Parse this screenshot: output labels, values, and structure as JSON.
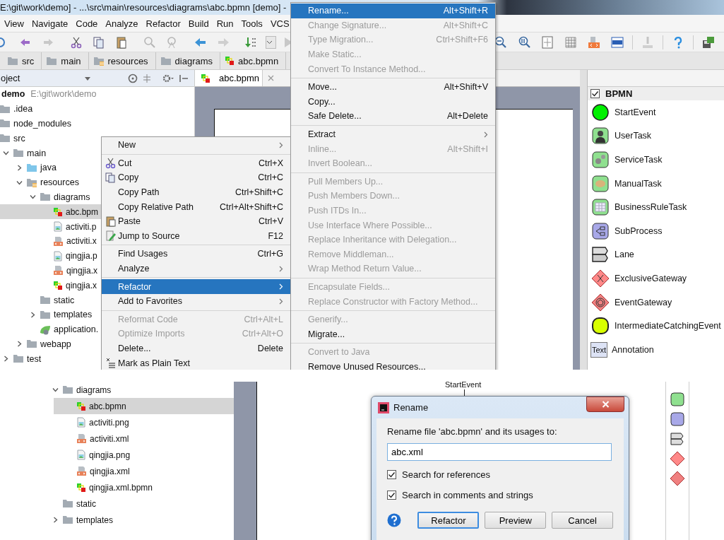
{
  "title_bar": {
    "title": "E:\\git\\work\\demo] - ...\\src\\main\\resources\\diagrams\\abc.bpmn [demo] -"
  },
  "menu_bar": [
    "View",
    "Navigate",
    "Code",
    "Analyze",
    "Refactor",
    "Build",
    "Run",
    "Tools",
    "VCS"
  ],
  "breadcrumb": [
    {
      "label": "src",
      "kind": "folder"
    },
    {
      "label": "main",
      "kind": "folder"
    },
    {
      "label": "resources",
      "kind": "resource_folder"
    },
    {
      "label": "diagrams",
      "kind": "folder"
    },
    {
      "label": "abc.bpmn",
      "kind": "bpmn"
    }
  ],
  "project_panel": {
    "title": "oject",
    "tree": [
      {
        "label": "demo",
        "path": "E:\\git\\work\\demo",
        "kind": "module",
        "selected": false,
        "children": [
          {
            "label": ".idea",
            "kind": "folder",
            "selected": false
          },
          {
            "label": "node_modules",
            "kind": "folder",
            "selected": false
          },
          {
            "label": "src",
            "kind": "folder",
            "selected": false,
            "children": [
              {
                "label": "main",
                "kind": "folder",
                "expanded": true,
                "selected": false,
                "children": [
                  {
                    "label": "java",
                    "kind": "source_folder",
                    "expanded": false,
                    "selected": false
                  },
                  {
                    "label": "resources",
                    "kind": "resource_folder",
                    "expanded": true,
                    "selected": false,
                    "children": [
                      {
                        "label": "diagrams",
                        "kind": "folder",
                        "expanded": true,
                        "selected": false,
                        "children": [
                          {
                            "label": "abc.bpm",
                            "kind": "bpmn",
                            "selected": true
                          },
                          {
                            "label": "activiti.p",
                            "kind": "image",
                            "selected": false
                          },
                          {
                            "label": "activiti.x",
                            "kind": "xml",
                            "selected": false
                          },
                          {
                            "label": "qingjia.p",
                            "kind": "image",
                            "selected": false
                          },
                          {
                            "label": "qingjia.x",
                            "kind": "xml",
                            "selected": false
                          },
                          {
                            "label": "qingjia.x",
                            "kind": "bpmn",
                            "selected": false
                          }
                        ]
                      },
                      {
                        "label": "static",
                        "kind": "folder",
                        "selected": false
                      },
                      {
                        "label": "templates",
                        "kind": "folder",
                        "expanded": false,
                        "selected": false
                      },
                      {
                        "label": "application.",
                        "kind": "config",
                        "selected": false
                      }
                    ]
                  },
                  {
                    "label": "webapp",
                    "kind": "folder",
                    "expanded": false,
                    "selected": false
                  }
                ]
              },
              {
                "label": "test",
                "kind": "folder",
                "expanded": false,
                "selected": false
              }
            ]
          }
        ]
      }
    ]
  },
  "editor_tab": {
    "label": "abc.bpmn",
    "selected": true
  },
  "context_menu": {
    "items": [
      {
        "kind": "item",
        "label": "New",
        "submenu": true,
        "disabled": false,
        "selected": false
      },
      {
        "kind": "separator"
      },
      {
        "kind": "item",
        "label": "Cut",
        "shortcut": "Ctrl+X",
        "submenu": false,
        "disabled": false,
        "selected": false
      },
      {
        "kind": "item",
        "label": "Copy",
        "shortcut": "Ctrl+C",
        "submenu": false,
        "disabled": false,
        "selected": false
      },
      {
        "kind": "item",
        "label": "Copy Path",
        "shortcut": "Ctrl+Shift+C",
        "submenu": false,
        "disabled": false,
        "selected": false
      },
      {
        "kind": "item",
        "label": "Copy Relative Path",
        "shortcut": "Ctrl+Alt+Shift+C",
        "submenu": false,
        "disabled": false,
        "selected": false
      },
      {
        "kind": "item",
        "label": "Paste",
        "shortcut": "Ctrl+V",
        "submenu": false,
        "disabled": false,
        "selected": false
      },
      {
        "kind": "item",
        "label": "Jump to Source",
        "shortcut": "F12",
        "submenu": false,
        "disabled": false,
        "selected": false
      },
      {
        "kind": "separator"
      },
      {
        "kind": "item",
        "label": "Find Usages",
        "shortcut": "Ctrl+G",
        "submenu": false,
        "disabled": false,
        "selected": false
      },
      {
        "kind": "item",
        "label": "Analyze",
        "submenu": true,
        "disabled": false,
        "selected": false
      },
      {
        "kind": "separator"
      },
      {
        "kind": "item",
        "label": "Refactor",
        "submenu": true,
        "disabled": false,
        "selected": true
      },
      {
        "kind": "item",
        "label": "Add to Favorites",
        "submenu": true,
        "disabled": false,
        "selected": false
      },
      {
        "kind": "separator"
      },
      {
        "kind": "item",
        "label": "Reformat Code",
        "shortcut": "Ctrl+Alt+L",
        "submenu": false,
        "disabled": true,
        "selected": false
      },
      {
        "kind": "item",
        "label": "Optimize Imports",
        "shortcut": "Ctrl+Alt+O",
        "submenu": false,
        "disabled": true,
        "selected": false
      },
      {
        "kind": "item",
        "label": "Delete...",
        "shortcut": "Delete",
        "submenu": false,
        "disabled": false,
        "selected": false
      },
      {
        "kind": "item",
        "label": "Mark as Plain Text",
        "submenu": false,
        "disabled": false,
        "selected": false
      }
    ]
  },
  "refactor_menu": {
    "items": [
      {
        "kind": "item",
        "label": "Rename...",
        "shortcut": "Alt+Shift+R",
        "submenu": false,
        "disabled": false,
        "selected": true
      },
      {
        "kind": "item",
        "label": "Change Signature...",
        "shortcut": "Alt+Shift+C",
        "submenu": false,
        "disabled": true,
        "selected": false
      },
      {
        "kind": "item",
        "label": "Type Migration...",
        "shortcut": "Ctrl+Shift+F6",
        "submenu": false,
        "disabled": true,
        "selected": false
      },
      {
        "kind": "item",
        "label": "Make Static...",
        "submenu": false,
        "disabled": true,
        "selected": false
      },
      {
        "kind": "item",
        "label": "Convert To Instance Method...",
        "submenu": false,
        "disabled": true,
        "selected": false
      },
      {
        "kind": "separator"
      },
      {
        "kind": "item",
        "label": "Move...",
        "shortcut": "Alt+Shift+V",
        "submenu": false,
        "disabled": false,
        "selected": false
      },
      {
        "kind": "item",
        "label": "Copy...",
        "submenu": false,
        "disabled": false,
        "selected": false
      },
      {
        "kind": "item",
        "label": "Safe Delete...",
        "shortcut": "Alt+Delete",
        "submenu": false,
        "disabled": false,
        "selected": false
      },
      {
        "kind": "separator"
      },
      {
        "kind": "item",
        "label": "Extract",
        "submenu": true,
        "disabled": false,
        "selected": false
      },
      {
        "kind": "item",
        "label": "Inline...",
        "shortcut": "Alt+Shift+I",
        "submenu": false,
        "disabled": true,
        "selected": false
      },
      {
        "kind": "item",
        "label": "Invert Boolean...",
        "submenu": false,
        "disabled": true,
        "selected": false
      },
      {
        "kind": "separator"
      },
      {
        "kind": "item",
        "label": "Pull Members Up...",
        "submenu": false,
        "disabled": true,
        "selected": false
      },
      {
        "kind": "item",
        "label": "Push Members Down...",
        "submenu": false,
        "disabled": true,
        "selected": false
      },
      {
        "kind": "item",
        "label": "Push ITDs In...",
        "submenu": false,
        "disabled": true,
        "selected": false
      },
      {
        "kind": "item",
        "label": "Use Interface Where Possible...",
        "submenu": false,
        "disabled": true,
        "selected": false
      },
      {
        "kind": "item",
        "label": "Replace Inheritance with Delegation...",
        "submenu": false,
        "disabled": true,
        "selected": false
      },
      {
        "kind": "item",
        "label": "Remove Middleman...",
        "submenu": false,
        "disabled": true,
        "selected": false
      },
      {
        "kind": "item",
        "label": "Wrap Method Return Value...",
        "submenu": false,
        "disabled": true,
        "selected": false
      },
      {
        "kind": "separator"
      },
      {
        "kind": "item",
        "label": "Encapsulate Fields...",
        "submenu": false,
        "disabled": true,
        "selected": false
      },
      {
        "kind": "item",
        "label": "Replace Constructor with Factory Method...",
        "submenu": false,
        "disabled": true,
        "selected": false
      },
      {
        "kind": "separator"
      },
      {
        "kind": "item",
        "label": "Generify...",
        "submenu": false,
        "disabled": true,
        "selected": false
      },
      {
        "kind": "item",
        "label": "Migrate...",
        "submenu": false,
        "disabled": false,
        "selected": false
      },
      {
        "kind": "separator"
      },
      {
        "kind": "item",
        "label": "Convert to Java",
        "submenu": false,
        "disabled": true,
        "selected": false
      },
      {
        "kind": "item",
        "label": "Remove Unused Resources...",
        "submenu": false,
        "disabled": false,
        "selected": false
      }
    ]
  },
  "palette": {
    "header": {
      "label": "BPMN",
      "checked": true
    },
    "items": [
      {
        "label": "StartEvent"
      },
      {
        "label": "UserTask"
      },
      {
        "label": "ServiceTask"
      },
      {
        "label": "ManualTask"
      },
      {
        "label": "BusinessRuleTask"
      },
      {
        "label": "SubProcess"
      },
      {
        "label": "Lane"
      },
      {
        "label": "ExclusiveGateway"
      },
      {
        "label": "EventGateway"
      },
      {
        "label": "IntermediateCatchingEvent"
      },
      {
        "label": "Annotation",
        "icon_text": "Text"
      }
    ]
  },
  "bottom_panel": {
    "tree": [
      {
        "label": "diagrams",
        "kind": "folder",
        "expanded": true,
        "selected": false,
        "children": [
          {
            "label": "abc.bpmn",
            "kind": "bpmn",
            "selected": true
          },
          {
            "label": "activiti.png",
            "kind": "image",
            "selected": false
          },
          {
            "label": "activiti.xml",
            "kind": "xml",
            "selected": false
          },
          {
            "label": "qingjia.png",
            "kind": "image",
            "selected": false
          },
          {
            "label": "qingjia.xml",
            "kind": "xml",
            "selected": false
          },
          {
            "label": "qingjia.xml.bpmn",
            "kind": "bpmn",
            "selected": false
          }
        ]
      },
      {
        "label": "static",
        "kind": "folder",
        "selected": false
      },
      {
        "label": "templates",
        "kind": "folder",
        "expanded": false,
        "selected": false
      }
    ],
    "canvas_label": "StartEvent",
    "dialog": {
      "title": "Rename",
      "prompt": "Rename file 'abc.bpmn' and its usages to:",
      "value": "abc.xml",
      "options": [
        {
          "label": "Search for references",
          "checked": true
        },
        {
          "label": "Search in comments and strings",
          "checked": true
        }
      ],
      "buttons": [
        {
          "label": "Refactor",
          "default": true
        },
        {
          "label": "Preview",
          "default": false
        },
        {
          "label": "Cancel",
          "default": false
        }
      ]
    }
  }
}
